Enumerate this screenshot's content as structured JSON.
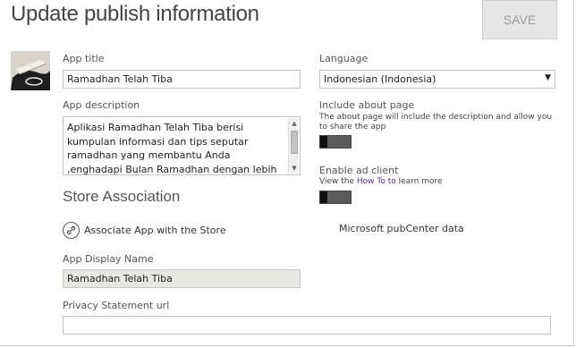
{
  "page": {
    "title": "Update publish information",
    "save_label": "SAVE"
  },
  "app_title": {
    "label": "App title",
    "value": "Ramadhan Telah Tiba"
  },
  "app_description": {
    "label": "App description",
    "value": "Aplikasi Ramadhan Telah Tiba berisi kumpulan informasi dan tips seputar ramadhan yang membantu Anda ,enghadapi Bulan Ramadhan dengan lebih baik."
  },
  "store_association": {
    "title": "Store Association",
    "associate_link": "Associate App with the Store",
    "display_name_label": "App Display Name",
    "display_name_value": "Ramadhan Telah Tiba",
    "privacy_label": "Privacy Statement url",
    "privacy_value": ""
  },
  "language": {
    "label": "Language",
    "selected": "Indonesian (Indonesia)"
  },
  "about_page": {
    "label": "Include about page",
    "helper": "The about page will include the description and allow you to share the app"
  },
  "ad_client": {
    "label": "Enable ad client",
    "helper_prefix": "View the ",
    "helper_link": "How To to",
    "helper_suffix": " learn more",
    "pubcenter_label": "Microsoft pubCenter data"
  },
  "icons": {
    "thumbnail": "app-thumbnail-image",
    "link": "link-icon",
    "dropdown": "chevron-down-icon"
  }
}
